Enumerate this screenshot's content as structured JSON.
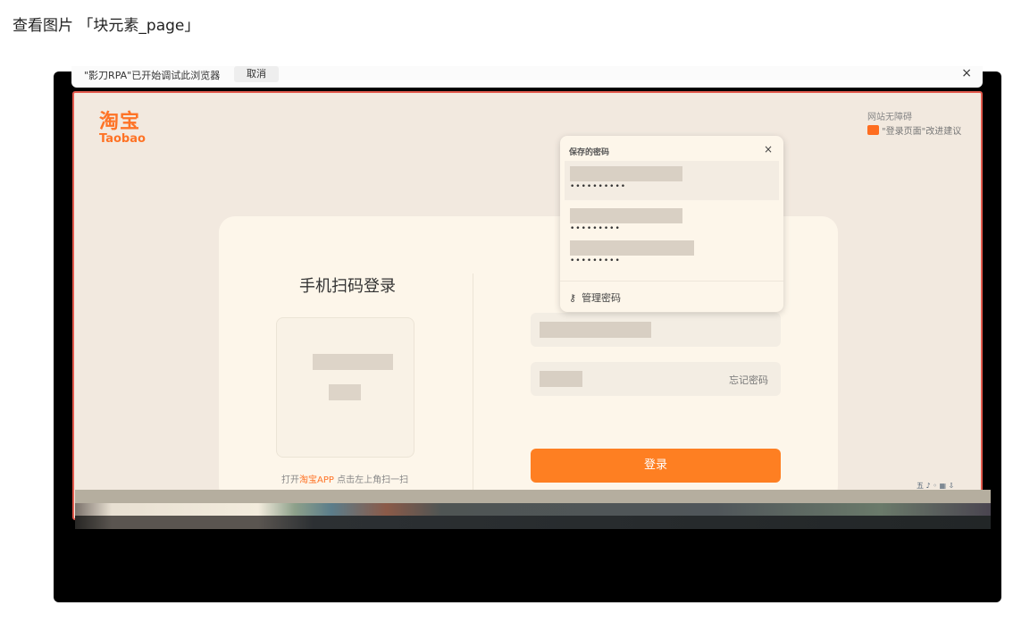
{
  "viewer_title": "查看图片 「块元素_page」",
  "infobar": {
    "message": "\"影刀RPA\"已开始调试此浏览器",
    "cancel": "取消",
    "close": "×"
  },
  "page": {
    "logo_cn": "淘宝",
    "logo_en": "Taobao",
    "accessibility": "网站无障碍",
    "feedback": "\"登录页面\"改进建议",
    "qr_title": "手机扫码登录",
    "qr_hint_prefix": "打开",
    "qr_hint_app": "淘宝APP",
    "qr_hint_suffix": " 点击左上角扫一扫",
    "forgot": "忘记密码",
    "login": "登录"
  },
  "password_popup": {
    "title": "保存的密码",
    "close": "×",
    "entries": [
      {
        "password": "••••••••••"
      },
      {
        "password": "•••••••••"
      },
      {
        "password": "•••••••••"
      }
    ],
    "manage": "管理密码"
  },
  "tray": "五 ♪ ◦ ▦ ⇩"
}
